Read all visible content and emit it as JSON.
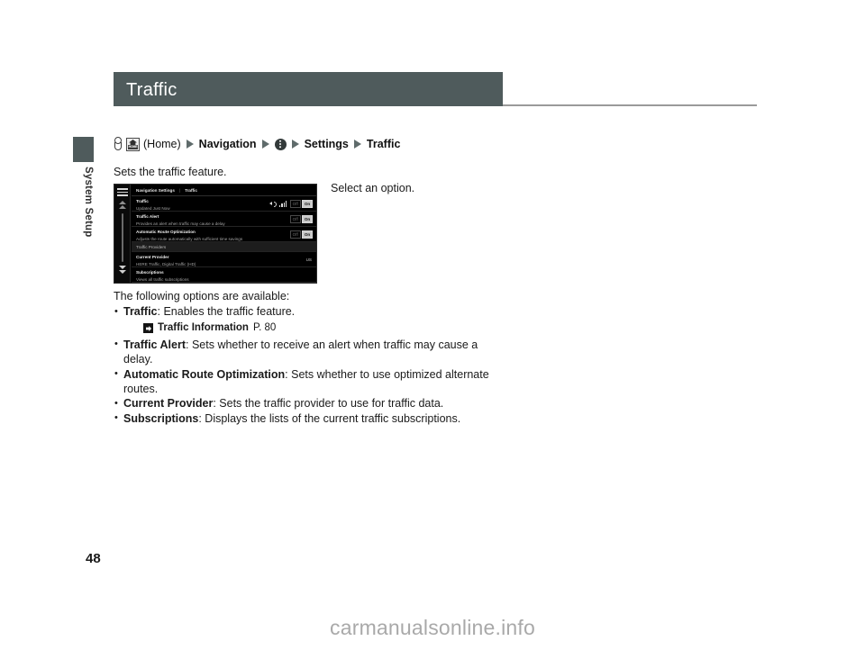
{
  "page": {
    "title": "Traffic",
    "number": "48",
    "chapter_tab": "System Setup",
    "watermark": "carmanualsonline.info"
  },
  "breadcrumb": {
    "hand_icon": "hand-pointer-icon",
    "home_icon": "home-button-icon",
    "home_word": "HOME",
    "home_label": "(Home)",
    "step_navigation": "Navigation",
    "info_icon": "vertical-ellipsis-icon",
    "step_settings": "Settings",
    "step_traffic": "Traffic",
    "arrow_icon": "triangle-right-icon"
  },
  "body": {
    "intro": "Sets the traffic feature.",
    "select_note": "Select an option.",
    "options_intro": "The following options are available:",
    "options": [
      {
        "term": "Traffic",
        "desc": ": Enables the traffic feature."
      },
      {
        "term": "Traffic Alert",
        "desc": ": Sets whether to receive an alert when traffic may cause a delay."
      },
      {
        "term": "Automatic Route Optimization",
        "desc": ": Sets whether to use optimized alternate routes."
      },
      {
        "term": "Current Provider",
        "desc": ": Sets the traffic provider to use for traffic data."
      },
      {
        "term": "Subscriptions",
        "desc": ": Displays the lists of the current traffic subscriptions."
      }
    ],
    "xref": {
      "icon": "jump-reference-icon",
      "label": "Traffic Information",
      "page": "P. 80"
    }
  },
  "device_screenshot": {
    "name": "navigation-settings-traffic-screen",
    "menu_icon": "hamburger-menu-icon",
    "scroll_up_icon": "scroll-up-arrow-icon",
    "scroll_down_icon": "scroll-down-arrow-icon",
    "titlebar": {
      "primary": "Navigation Settings",
      "separator": "|",
      "secondary": "Traffic"
    },
    "status": {
      "speaker_icon": "speaker-icon",
      "signal_icon": "signal-bars-icon"
    },
    "rows": [
      {
        "title": "Traffic",
        "subtitle": "Updated Just Now",
        "toggle_off": "Off",
        "toggle_on": "On",
        "state": "On"
      },
      {
        "title": "Traffic Alert",
        "subtitle": "Provides an alert when traffic may cause a delay",
        "toggle_off": "Off",
        "toggle_on": "On",
        "state": "On"
      },
      {
        "title": "Automatic Route Optimization",
        "subtitle": "Adjusts the route automatically with sufficient time savings",
        "toggle_off": "Off",
        "toggle_on": "On",
        "state": "On"
      }
    ],
    "section_header": "Traffic Providers",
    "provider_row": {
      "title": "Current Provider",
      "subtitle": "HERE Traffic, Digital Traffic (HD)",
      "badge": "US"
    },
    "subscriptions_row": {
      "title": "Subscriptions",
      "subtitle": "Views all traffic subscriptions"
    }
  },
  "colors": {
    "header_bar": "#4f5b5c",
    "arrow": "#5f6b6b",
    "watermark": "#a9a9a9"
  }
}
